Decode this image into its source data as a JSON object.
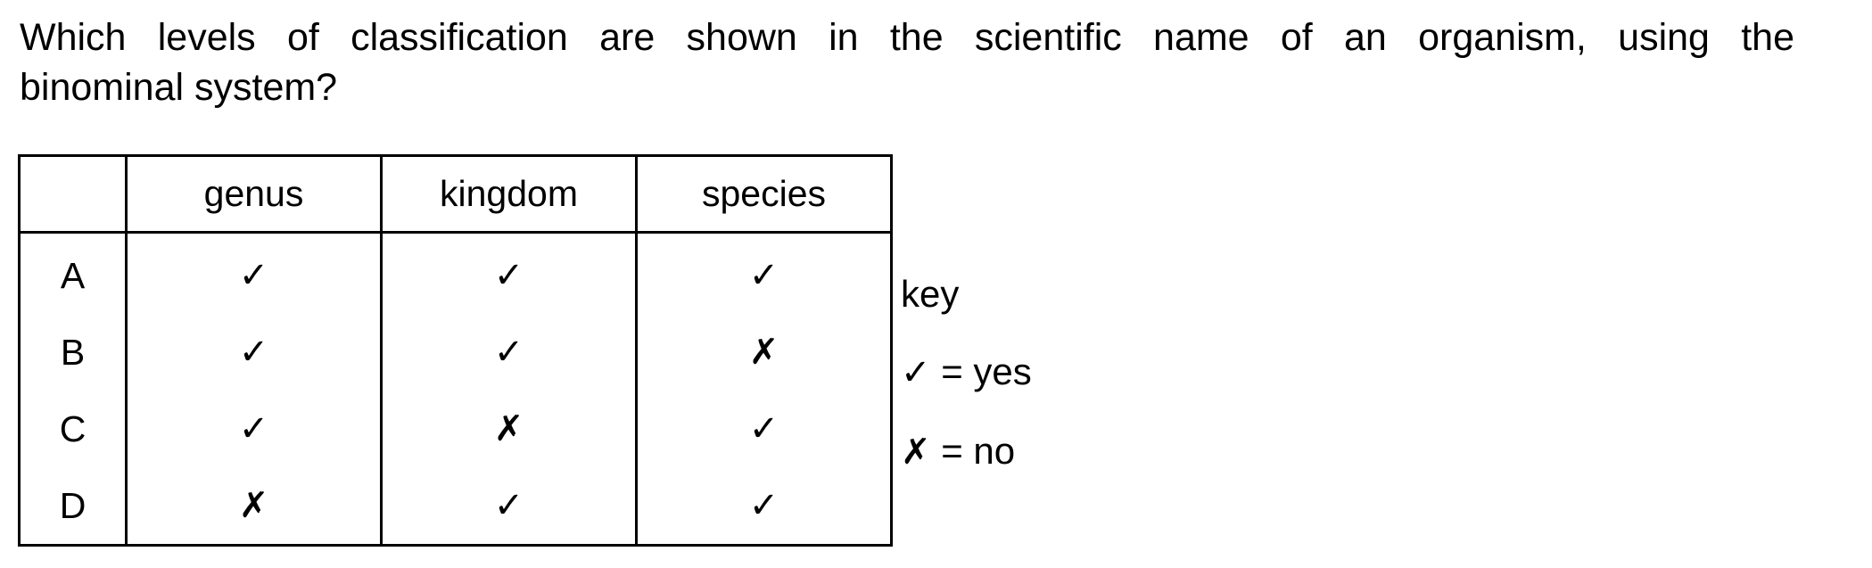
{
  "question": {
    "line1": "Which levels of classification are shown in the scientific name of an organism, using the",
    "line2": "binominal system?"
  },
  "table": {
    "columns": [
      "",
      "genus",
      "kingdom",
      "species"
    ],
    "rows": [
      {
        "label": "A",
        "cells": [
          "✓",
          "✓",
          "✓"
        ]
      },
      {
        "label": "B",
        "cells": [
          "✓",
          "✓",
          "✗"
        ]
      },
      {
        "label": "C",
        "cells": [
          "✓",
          "✗",
          "✓"
        ]
      },
      {
        "label": "D",
        "cells": [
          "✗",
          "✓",
          "✓"
        ]
      }
    ]
  },
  "key": {
    "title": "key",
    "yes_symbol": "✓",
    "yes_text": "= yes",
    "no_symbol": "✗",
    "no_text": "= no"
  }
}
